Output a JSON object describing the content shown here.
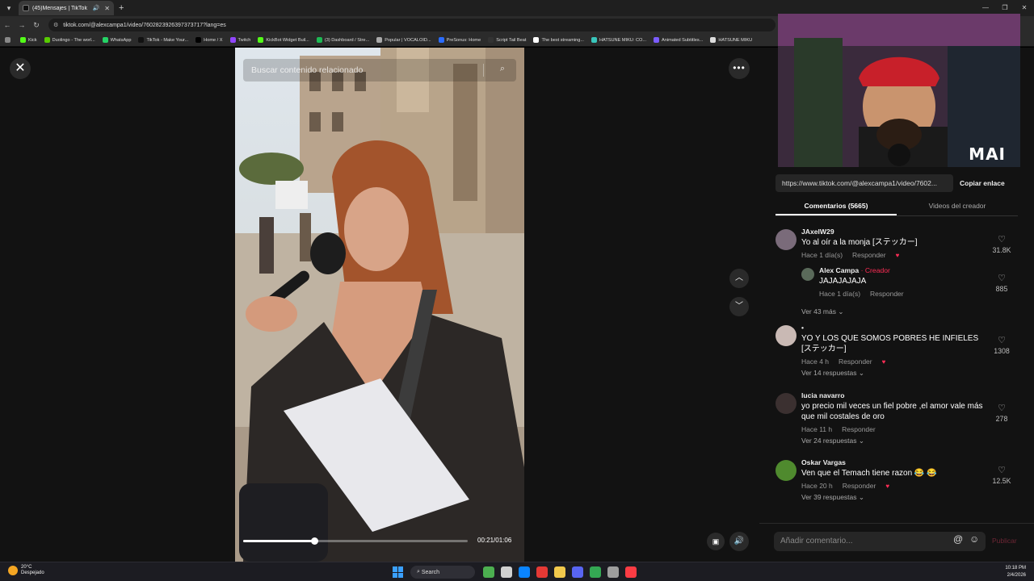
{
  "browser": {
    "tab_title": "(45)Mensajes | TikTok",
    "new_tab": "+",
    "url": "tiktok.com/@alexcampa1/video/7602823926397373717?lang=es",
    "bookmarks": [
      {
        "label": "Kick",
        "color": "#53fc18"
      },
      {
        "label": "Duolingo - The worl...",
        "color": "#58cc02"
      },
      {
        "label": "WhatsApp",
        "color": "#25d366"
      },
      {
        "label": "TikTok - Make Your...",
        "color": "#111111"
      },
      {
        "label": "Home / X",
        "color": "#000000"
      },
      {
        "label": "Twitch",
        "color": "#9146ff"
      },
      {
        "label": "KickBot Widget Buil...",
        "color": "#53fc18"
      },
      {
        "label": "(3) Dashboard / Stre...",
        "color": "#1db954"
      },
      {
        "label": "Popular | VOCALOID...",
        "color": "#aaaaaa"
      },
      {
        "label": "PreSonus: Home",
        "color": "#2b6cff"
      },
      {
        "label": "Script Tail Beat",
        "color": "#333333"
      },
      {
        "label": "The best streaming...",
        "color": "#ffffff"
      },
      {
        "label": "HATSUNE MIKU: CO...",
        "color": "#39c5bb"
      },
      {
        "label": "Animated Subtitles...",
        "color": "#7b5cff"
      },
      {
        "label": "HATSUNE MIKU",
        "color": "#dddddd"
      }
    ]
  },
  "video": {
    "search_placeholder": "Buscar contenido relacionado",
    "time": "00:21/01:06",
    "progress_fraction": 0.318
  },
  "webcam": {
    "watermark": "MAI"
  },
  "panel": {
    "link": "https://www.tiktok.com/@alexcampa1/video/7602...",
    "copy_label": "Copiar enlace",
    "tab_comments": "Comentarios (5665)",
    "tab_creator": "Videos del creador",
    "add_placeholder": "Añadir comentario...",
    "publish": "Publicar",
    "reply_label": "Responder"
  },
  "comments": [
    {
      "user": "JAxelW29",
      "text": "Yo al oír a la monja [ステッカー]",
      "time": "Hace 1 día(s)",
      "likes": "31.8K",
      "avatar_color": "#7a6b7a"
    },
    {
      "user": "Alex Campa",
      "creator": "· Creador",
      "text": "JAJAJAJAJA",
      "time": "Hace 1 día(s)",
      "likes": "885",
      "avatar_color": "#5a6a5a"
    },
    {
      "more": "Ver 43 más"
    },
    {
      "user": "•",
      "text": "YO Y LOS QUE SOMOS POBRES HE INFIELES [ステッカー]",
      "time": "Hace 4 h",
      "likes": "1308",
      "more": "Ver 14 respuestas",
      "avatar_color": "#c9b9b4"
    },
    {
      "user": "lucia navarro",
      "text": "yo precio mil veces un fiel pobre ,el amor vale más que mil costales de oro",
      "time": "Hace 11 h",
      "likes": "278",
      "more": "Ver 24 respuestas",
      "avatar_color": "#3b3030"
    },
    {
      "user": "Oskar Vargas",
      "text": "Ven que el Temach tiene razon 😂 😂",
      "time": "Hace 20 h",
      "likes": "12.5K",
      "more": "Ver 39 respuestas",
      "avatar_color": "#4f8a2e"
    }
  ],
  "taskbar": {
    "temp": "20°C",
    "weather": "Despejado",
    "search": "Search",
    "time": "10:18 PM",
    "date": "2/4/2026"
  }
}
